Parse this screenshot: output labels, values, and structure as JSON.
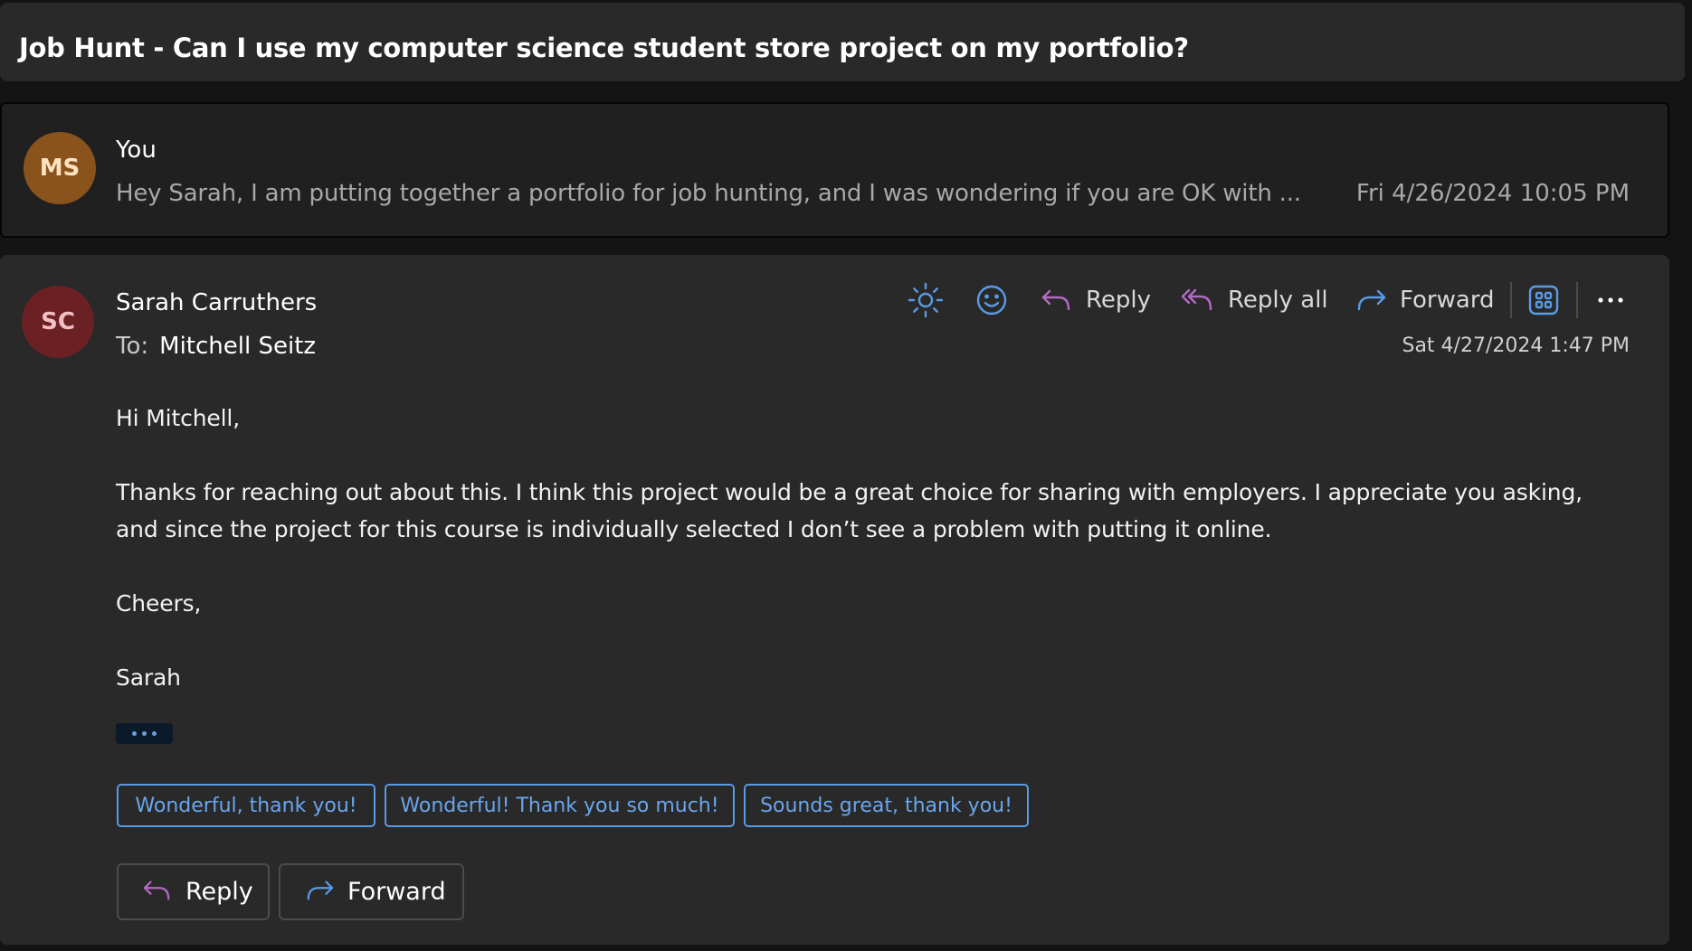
{
  "conversation": {
    "subject": "Job Hunt - Can I use my computer science student store project on my portfolio?"
  },
  "messages": [
    {
      "state": "collapsed",
      "avatar_initials": "MS",
      "avatar_color": "#8b531c",
      "sender": "You",
      "preview": "Hey Sarah, I am putting together a portfolio for job hunting, and I was wondering if you are OK with ...",
      "date": "Fri 4/26/2024 10:05 PM"
    },
    {
      "state": "expanded",
      "avatar_initials": "SC",
      "avatar_color": "#6b2123",
      "sender": "Sarah Carruthers",
      "to_label": "To:",
      "to": "Mitchell Seitz",
      "date": "Sat 4/27/2024 1:47 PM",
      "toolbar": {
        "brightness_icon": "sun-icon",
        "react_icon": "smiley-icon",
        "reply_label": "Reply",
        "reply_all_label": "Reply all",
        "forward_label": "Forward",
        "apps_icon": "apps-grid-icon",
        "more_icon": "more-options-icon"
      },
      "body": {
        "greeting": "Hi Mitchell,",
        "paragraph_line1": "Thanks for reaching out about this. I think this project would be a great choice for sharing with employers. I appreciate you asking,",
        "paragraph_line2": "and since the project for this course is individually selected I don’t see a problem with putting it online.",
        "closing": "Cheers,",
        "signature": "Sarah"
      },
      "show_trimmed_content": "...",
      "quick_replies": [
        "Wonderful, thank you!",
        "Wonderful! Thank you so much!",
        "Sounds great, thank you!"
      ],
      "actions": {
        "reply_label": "Reply",
        "forward_label": "Forward"
      }
    }
  ],
  "colors": {
    "accent_blue": "#5a9be6",
    "reply_purple": "#b36ac4"
  }
}
